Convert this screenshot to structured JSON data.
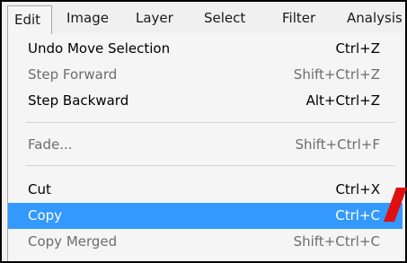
{
  "menubar": {
    "items": [
      "Edit",
      "Image",
      "Layer",
      "Select",
      "Filter",
      "Analysis"
    ]
  },
  "menu": {
    "items": [
      {
        "label": "Undo Move Selection",
        "shortcut": "Ctrl+Z",
        "state": "enabled"
      },
      {
        "label": "Step Forward",
        "shortcut": "Shift+Ctrl+Z",
        "state": "disabled"
      },
      {
        "label": "Step Backward",
        "shortcut": "Alt+Ctrl+Z",
        "state": "enabled"
      },
      {
        "label": "Fade...",
        "shortcut": "Shift+Ctrl+F",
        "state": "disabled"
      },
      {
        "label": "Cut",
        "shortcut": "Ctrl+X",
        "state": "enabled"
      },
      {
        "label": "Copy",
        "shortcut": "Ctrl+C",
        "state": "highlighted"
      },
      {
        "label": "Copy Merged",
        "shortcut": "Shift+Ctrl+C",
        "state": "disabled"
      }
    ]
  },
  "colors": {
    "highlight": "#3399ff",
    "pointer_arrow": "#e01010",
    "disabled_text": "#6d6d6d"
  },
  "pointer": {
    "icon": "red-pointer-arrow-icon"
  }
}
